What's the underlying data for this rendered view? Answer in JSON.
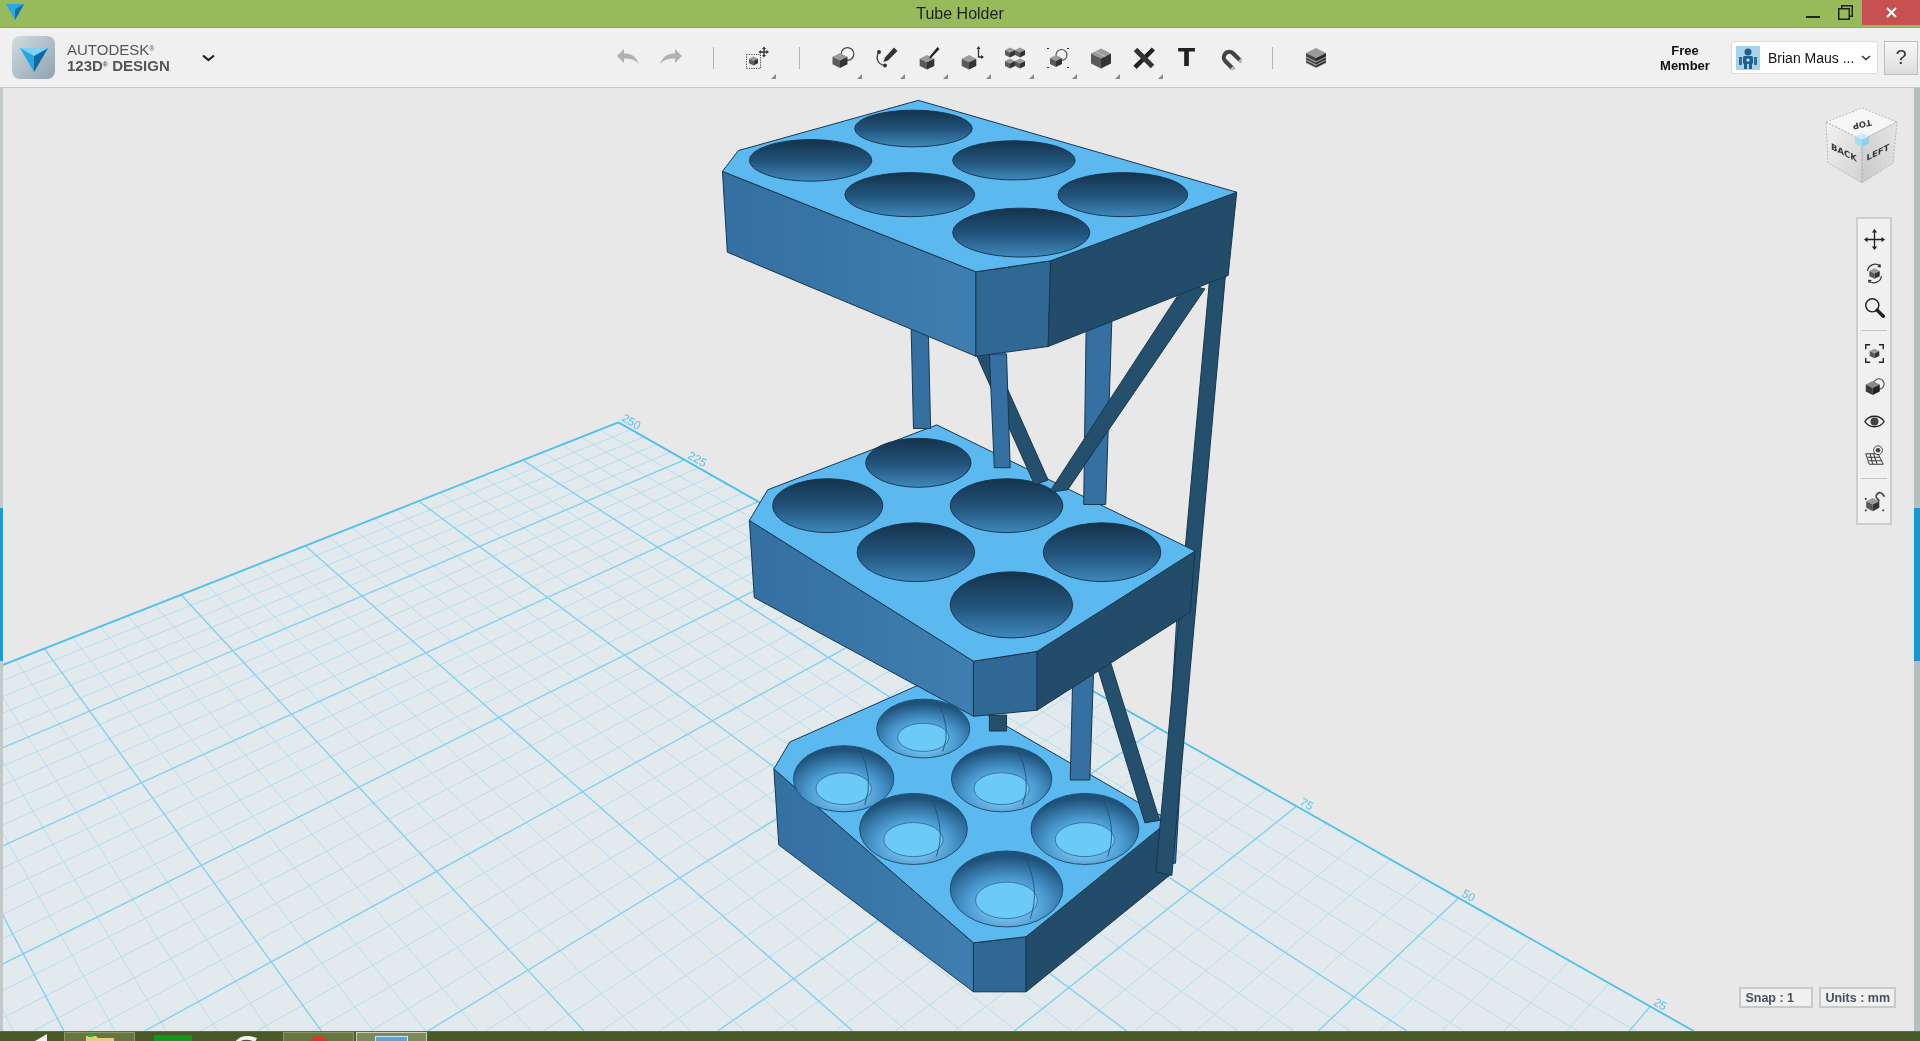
{
  "window": {
    "title": "Tube Holder"
  },
  "app": {
    "brand": "AUTODESK$^{®}$",
    "product": "123D$^{®}$ DESIGN"
  },
  "toolbar": {
    "groups": [
      [
        {
          "kind": "undo",
          "disabled": true,
          "dropdown": false
        },
        {
          "kind": "redo",
          "disabled": true,
          "dropdown": false
        }
      ],
      [
        {
          "kind": "transform",
          "disabled": false,
          "dropdown": true
        }
      ],
      [
        {
          "kind": "primitives",
          "disabled": false,
          "dropdown": true
        },
        {
          "kind": "sketch",
          "disabled": false,
          "dropdown": true
        },
        {
          "kind": "construct",
          "disabled": false,
          "dropdown": true
        },
        {
          "kind": "modify",
          "disabled": false,
          "dropdown": true
        },
        {
          "kind": "pattern",
          "disabled": false,
          "dropdown": true
        },
        {
          "kind": "grouping",
          "disabled": false,
          "dropdown": true
        },
        {
          "kind": "combine",
          "disabled": false,
          "dropdown": true
        },
        {
          "kind": "measure",
          "disabled": false,
          "dropdown": true
        },
        {
          "kind": "text",
          "glyph": "T",
          "disabled": false,
          "dropdown": false
        },
        {
          "kind": "snap",
          "disabled": false,
          "dropdown": false
        }
      ],
      [
        {
          "kind": "materials",
          "disabled": false,
          "dropdown": false
        }
      ]
    ]
  },
  "account": {
    "membership": "Free Member",
    "user": "Brian Maus ...",
    "help": "?"
  },
  "viewport": {
    "grid_labels": [
      "250",
      "225",
      "75",
      "50",
      "25"
    ],
    "view_cube": {
      "faces": [
        "TOP",
        "BACK",
        "LEFT"
      ]
    },
    "navigation": [
      {
        "kind": "pan"
      },
      {
        "kind": "orbit"
      },
      {
        "kind": "zoom"
      },
      {
        "kind": "separator"
      },
      {
        "kind": "fit"
      },
      {
        "kind": "views"
      },
      {
        "kind": "visibility"
      },
      {
        "kind": "grid"
      },
      {
        "kind": "separator"
      },
      {
        "kind": "snap"
      }
    ],
    "status": [
      "Snap : 1",
      "Units : mm"
    ]
  },
  "taskbar": {
    "items": [
      {
        "kind": "folder",
        "running": true,
        "selected": false
      },
      {
        "kind": "tile",
        "running": false,
        "selected": false
      },
      {
        "kind": "swirl",
        "running": false,
        "selected": false
      },
      {
        "kind": "ball",
        "running": true,
        "selected": false
      },
      {
        "kind": "window",
        "running": true,
        "selected": true
      }
    ]
  }
}
